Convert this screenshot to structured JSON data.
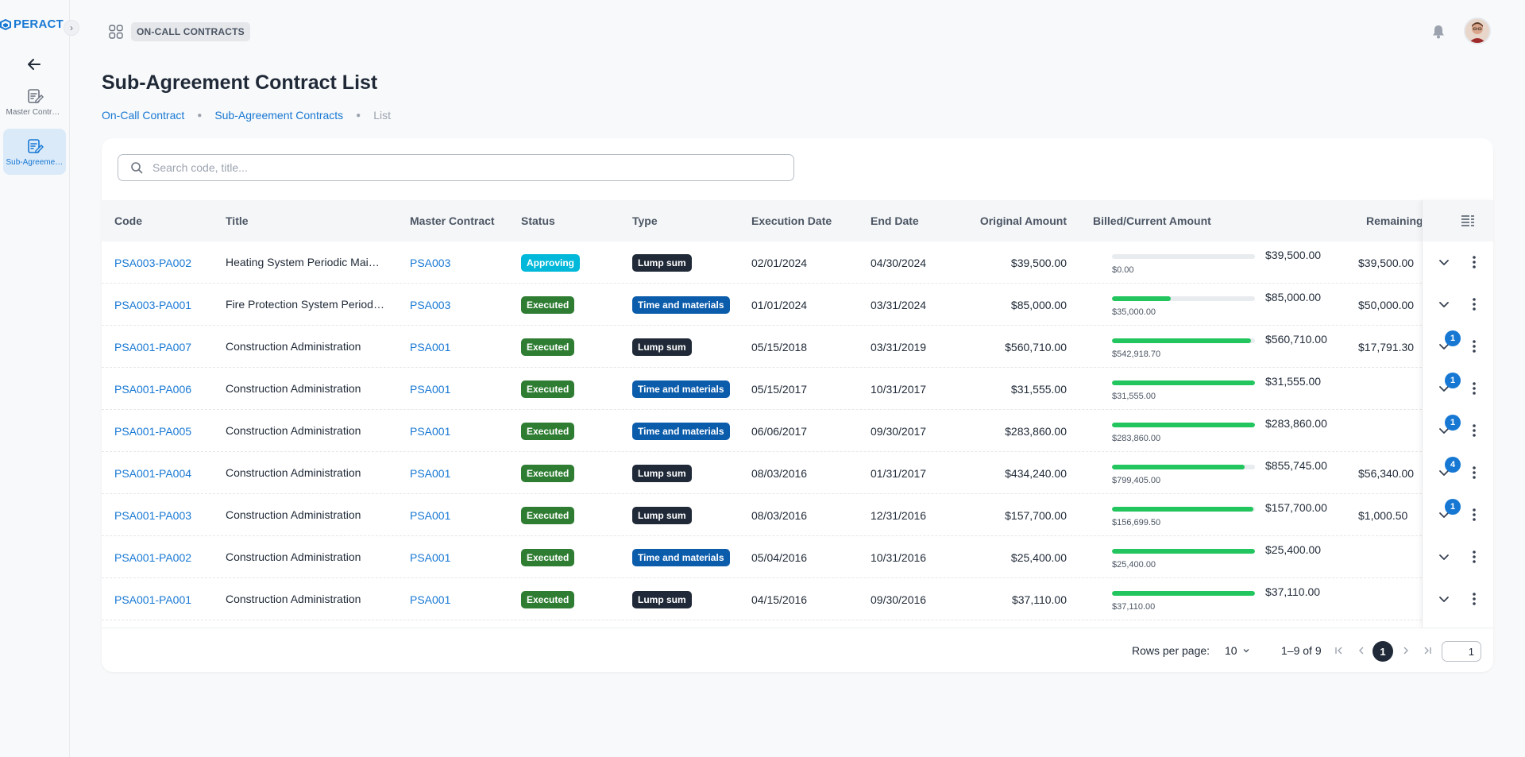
{
  "sidebar": {
    "logo": "PERACT",
    "items": [
      {
        "label": "Master Contracts"
      },
      {
        "label": "Sub-Agreements"
      }
    ]
  },
  "header": {
    "section_chip": "ON-CALL CONTRACTS"
  },
  "page": {
    "title": "Sub-Agreement Contract List",
    "breadcrumb": [
      "On-Call Contract",
      "Sub-Agreement Contracts",
      "List"
    ]
  },
  "search": {
    "placeholder": "Search code, title...",
    "value": ""
  },
  "table": {
    "columns": {
      "code": "Code",
      "title": "Title",
      "master": "Master Contract",
      "status": "Status",
      "type": "Type",
      "exec_date": "Execution Date",
      "end_date": "End Date",
      "original": "Original Amount",
      "billed": "Billed/Current Amount",
      "remaining": "Remaining"
    },
    "rows": [
      {
        "code": "PSA003-PA002",
        "title": "Heating System Periodic Maintenance",
        "master": "PSA003",
        "status": "Approving",
        "type": "Lump sum",
        "exec_date": "02/01/2024",
        "end_date": "04/30/2024",
        "original": "$39,500.00",
        "billed": "$0.00",
        "current": "$39,500.00",
        "billed_fraction": 0.0,
        "remaining": "$39,500.00",
        "badge": ""
      },
      {
        "code": "PSA003-PA001",
        "title": "Fire Protection System Periodic Maintenance",
        "master": "PSA003",
        "status": "Executed",
        "type": "Time and materials",
        "exec_date": "01/01/2024",
        "end_date": "03/31/2024",
        "original": "$85,000.00",
        "billed": "$35,000.00",
        "current": "$85,000.00",
        "billed_fraction": 0.41,
        "remaining": "$50,000.00",
        "badge": ""
      },
      {
        "code": "PSA001-PA007",
        "title": "Construction Administration",
        "master": "PSA001",
        "status": "Executed",
        "type": "Lump sum",
        "exec_date": "05/15/2018",
        "end_date": "03/31/2019",
        "original": "$560,710.00",
        "billed": "$542,918.70",
        "current": "$560,710.00",
        "billed_fraction": 0.968,
        "remaining": "$17,791.30",
        "badge": "1"
      },
      {
        "code": "PSA001-PA006",
        "title": "Construction Administration",
        "master": "PSA001",
        "status": "Executed",
        "type": "Time and materials",
        "exec_date": "05/15/2017",
        "end_date": "10/31/2017",
        "original": "$31,555.00",
        "billed": "$31,555.00",
        "current": "$31,555.00",
        "billed_fraction": 1.0,
        "remaining": "",
        "badge": "1"
      },
      {
        "code": "PSA001-PA005",
        "title": "Construction Administration",
        "master": "PSA001",
        "status": "Executed",
        "type": "Time and materials",
        "exec_date": "06/06/2017",
        "end_date": "09/30/2017",
        "original": "$283,860.00",
        "billed": "$283,860.00",
        "current": "$283,860.00",
        "billed_fraction": 1.0,
        "remaining": "",
        "badge": "1"
      },
      {
        "code": "PSA001-PA004",
        "title": "Construction Administration",
        "master": "PSA001",
        "status": "Executed",
        "type": "Lump sum",
        "exec_date": "08/03/2016",
        "end_date": "01/31/2017",
        "original": "$434,240.00",
        "billed": "$799,405.00",
        "current": "$855,745.00",
        "billed_fraction": 0.934,
        "remaining": "$56,340.00",
        "badge": "4"
      },
      {
        "code": "PSA001-PA003",
        "title": "Construction Administration",
        "master": "PSA001",
        "status": "Executed",
        "type": "Lump sum",
        "exec_date": "08/03/2016",
        "end_date": "12/31/2016",
        "original": "$157,700.00",
        "billed": "$156,699.50",
        "current": "$157,700.00",
        "billed_fraction": 0.994,
        "remaining": "$1,000.50",
        "badge": "1"
      },
      {
        "code": "PSA001-PA002",
        "title": "Construction Administration",
        "master": "PSA001",
        "status": "Executed",
        "type": "Time and materials",
        "exec_date": "05/04/2016",
        "end_date": "10/31/2016",
        "original": "$25,400.00",
        "billed": "$25,400.00",
        "current": "$25,400.00",
        "billed_fraction": 1.0,
        "remaining": "",
        "badge": ""
      },
      {
        "code": "PSA001-PA001",
        "title": "Construction Administration",
        "master": "PSA001",
        "status": "Executed",
        "type": "Lump sum",
        "exec_date": "04/15/2016",
        "end_date": "09/30/2016",
        "original": "$37,110.00",
        "billed": "$37,110.00",
        "current": "$37,110.00",
        "billed_fraction": 1.0,
        "remaining": "",
        "badge": ""
      }
    ]
  },
  "pagination": {
    "rows_per_page_label": "Rows per page:",
    "rows_per_page": "10",
    "range": "1–9 of 9",
    "current_page": "1",
    "page_input": "1"
  },
  "colors": {
    "accent": "#1778d4",
    "approving": "#00b8d9",
    "executed": "#2e7d32",
    "lump_sum": "#1f2937",
    "time_materials": "#0b5cab",
    "progress": "#22c55e"
  }
}
